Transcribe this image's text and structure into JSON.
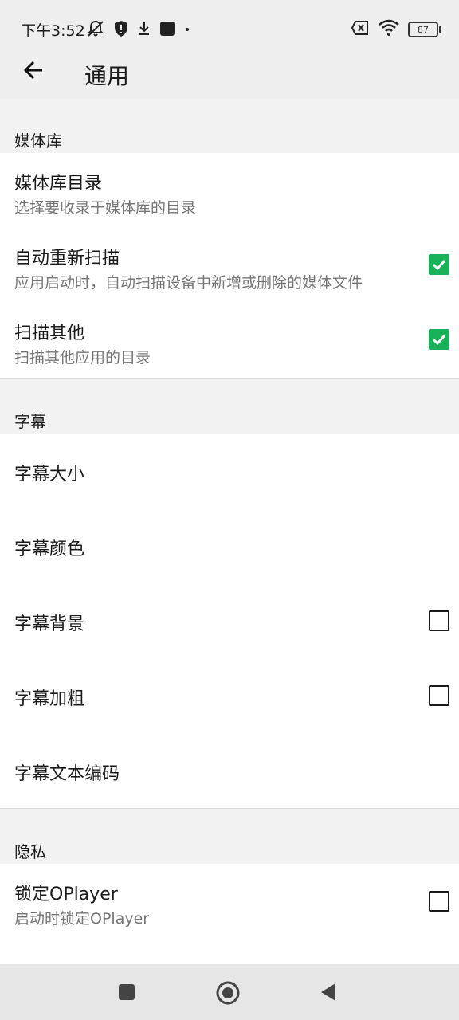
{
  "status_bar": {
    "time": "下午3:52",
    "battery": "87",
    "icons": [
      "bell-off-icon",
      "shield-icon",
      "download-icon",
      "square-icon",
      "dot-icon",
      "sim-x-icon",
      "wifi-icon",
      "battery-icon"
    ]
  },
  "app_bar": {
    "title": "通用",
    "back_icon": "arrow-left-icon"
  },
  "sections": [
    {
      "header": "媒体库",
      "items": [
        {
          "title": "媒体库目录",
          "subtitle": "选择要收录于媒体库的目录",
          "checkbox": null
        },
        {
          "title": "自动重新扫描",
          "subtitle": "应用启动时，自动扫描设备中新增或删除的媒体文件",
          "checkbox": true
        },
        {
          "title": "扫描其他",
          "subtitle": "扫描其他应用的目录",
          "checkbox": true
        }
      ]
    },
    {
      "header": "字幕",
      "items": [
        {
          "title": "字幕大小",
          "checkbox": null
        },
        {
          "title": "字幕颜色",
          "checkbox": null
        },
        {
          "title": "字幕背景",
          "checkbox": false
        },
        {
          "title": "字幕加粗",
          "checkbox": false
        },
        {
          "title": "字幕文本编码",
          "checkbox": null
        }
      ]
    },
    {
      "header": "隐私",
      "items": [
        {
          "title": "锁定OPlayer",
          "subtitle": "启动时锁定OPlayer",
          "checkbox": false
        }
      ]
    }
  ],
  "nav_bar": {
    "icons": [
      "recents-square-icon",
      "home-circle-icon",
      "back-triangle-icon"
    ]
  },
  "colors": {
    "accent": "#19b25b",
    "background": "#f2f2f2",
    "surface": "#ffffff",
    "secondary_text": "#757575"
  }
}
